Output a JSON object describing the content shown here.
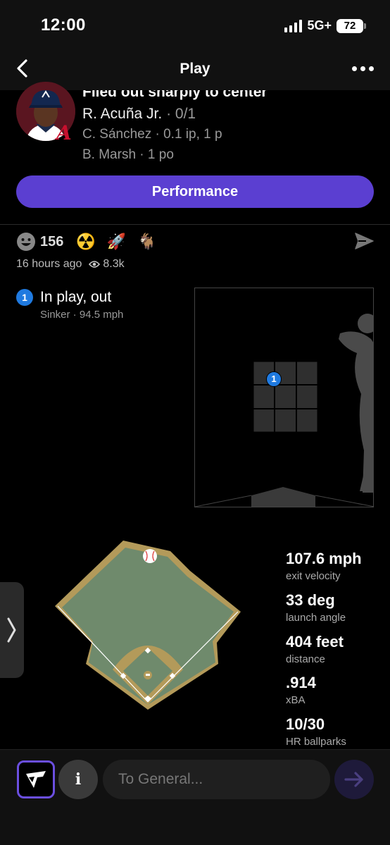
{
  "status": {
    "time": "12:00",
    "network": "5G+",
    "battery": "72"
  },
  "nav": {
    "title": "Play"
  },
  "play": {
    "headline": "Flied out sharply to center",
    "batter": "R. Acuña Jr.",
    "batter_stat": "· 0/1",
    "pitcher": "C. Sánchez · 0.1 ip, 1 p",
    "fielder": "B. Marsh · 1 po"
  },
  "performance_label": "Performance",
  "social": {
    "reaction_count": "156",
    "emojis": [
      "☢️",
      "🚀",
      "🐐"
    ],
    "posted": "16 hours ago",
    "views": "8.3k"
  },
  "pitch": {
    "number": "1",
    "result": "In play, out",
    "detail": "Sinker ·  94.5 mph"
  },
  "stats": [
    {
      "value": "107.6 mph",
      "label": "exit velocity"
    },
    {
      "value": "33 deg",
      "label": "launch angle"
    },
    {
      "value": "404 feet",
      "label": "distance"
    },
    {
      "value": ".914",
      "label": "xBA"
    },
    {
      "value": "10/30",
      "label": "HR ballparks"
    }
  ],
  "composer": {
    "info_label": "i",
    "placeholder": "To General..."
  },
  "colors": {
    "accent": "#5b3fd1",
    "pitch_badge": "#1f7ae0",
    "field_grass": "#6f8a6c",
    "field_dirt": "#b39a5a"
  }
}
